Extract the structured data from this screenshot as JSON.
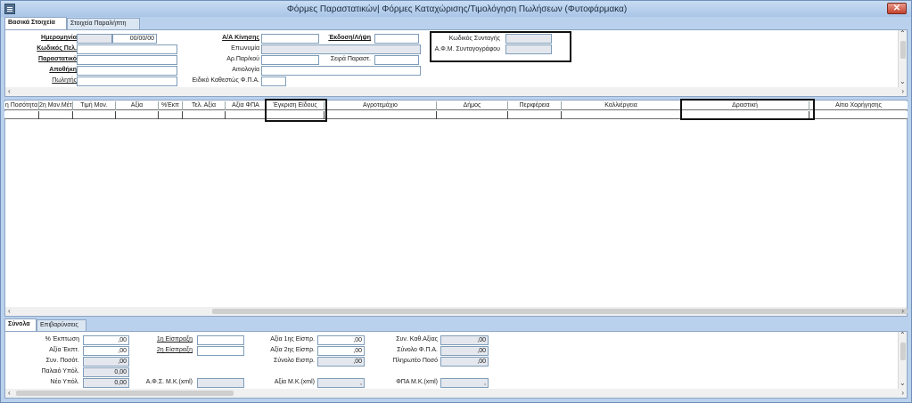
{
  "window": {
    "title": "Φόρμες Παραστατικών| Φόρμες Καταχώρισης/Τιμολόγηση Πωλήσεων (Φυτοφάρμακα)",
    "close_label": "✕"
  },
  "top_tabs": [
    "Βασικά Στοιχεία",
    "Στοιχεία Παραλήπτη"
  ],
  "header": {
    "date_label": "Ημερομηνία",
    "date_value": "00/00/00",
    "customer_code_label": "Κωδικός Πελ.",
    "document_label": "Παραστατικό",
    "warehouse_label": "Αποθήκη",
    "seller_label": "Πωλητής",
    "movement_no_label": "Α/Α Κίνησης",
    "issue_label": "Έκδοση/Λήψη",
    "company_name_label": "Επωνυμία",
    "document_no_label": "Αρ.Παρ/κού",
    "series_label": "Σειρά Παραστ.",
    "reason_label": "Αιτιολογία",
    "vat_regime_label": "Ειδικό Καθεστώς Φ.Π.Α.",
    "prescription_code_label": "Κωδικός Συνταγής",
    "prescriber_vat_label": "Α.Φ.Μ. Συνταγογράφου"
  },
  "grid": {
    "columns": [
      "η Ποσότητα",
      "2η Μον.Μέτ.",
      "Τιμή Μον.",
      "Αξία",
      "%Έκπ",
      "Τελ. Αξία",
      "Αξία ΦΠΑ",
      "Έγκριση Είδους",
      "Αγροτεμάχιο",
      "Δήμος",
      "Περιφέρεια",
      "Καλλιέργεια",
      "Δραστική",
      "Αίτιο Χορήγησης"
    ]
  },
  "bottom_tabs": [
    "Σύνολα",
    "Επιβαρύνσεις"
  ],
  "totals": {
    "discount_pct_label": "% Έκπτωση",
    "discount_pct_value": ",00",
    "discount_value_label": "Αξία Έκπτ.",
    "discount_value_value": ",00",
    "total_qty_label": "Συν. Ποσότ.",
    "total_qty_value": ",00",
    "old_balance_label": "Παλαιό Υπόλ.",
    "old_balance_value": "0,00",
    "new_balance_label": "Νέο Υπόλ.",
    "new_balance_value": "0,00",
    "collection1_label": "1η Είσπραξη",
    "collection2_label": "2η Είσπραξη",
    "afs_label": "Α.Φ.Σ. Μ.Κ.(xml)",
    "collection1_value_label": "Αξία 1ης Είσπρ.",
    "collection1_value": ",00",
    "collection2_value_label": "Αξία 2ης Είσπρ.",
    "collection2_value": ",00",
    "collections_total_label": "Σύνολο Εισπρ.",
    "collections_total": ",00",
    "mk_value_label": "Αξία Μ.Κ.(xml)",
    "mk_value": ",",
    "net_value_label": "Συν. Καθ.Αξίας",
    "net_value": ",00",
    "vat_total_label": "Σύνολο Φ.Π.Α.",
    "vat_total": ",00",
    "payable_label": "Πληρωτέο Ποσό",
    "payable": ",00",
    "mk_vat_label": "ΦΠΑ Μ.Κ.(xml)",
    "mk_vat": ","
  }
}
